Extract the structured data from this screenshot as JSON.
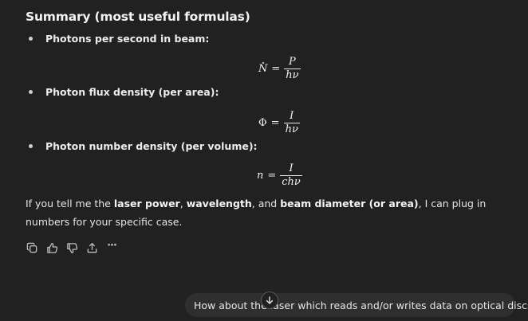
{
  "summary": {
    "heading": "Summary (most useful formulas)",
    "items": [
      {
        "label": "Photons per second in beam:",
        "lhs": "N",
        "eq": "=",
        "num": "P",
        "den": "hν"
      },
      {
        "label": "Photon flux density (per area):",
        "lhs": "Φ",
        "eq": "=",
        "num": "I",
        "den": "hν"
      },
      {
        "label": "Photon number density (per volume):",
        "lhs": "n",
        "eq": "=",
        "num": "I",
        "den": "chν"
      }
    ]
  },
  "followup": {
    "part1": "If you tell me the ",
    "bold1": "laser power",
    "sep1": ", ",
    "bold2": "wavelength",
    "sep2": ", and ",
    "bold3": "beam diameter (or area)",
    "part2": ", I can plug in numbers for your specific case."
  },
  "actions": [
    {
      "name": "copy-icon"
    },
    {
      "name": "thumbs-up-icon"
    },
    {
      "name": "thumbs-down-icon"
    },
    {
      "name": "share-icon"
    },
    {
      "name": "more-icon",
      "text": "···"
    }
  ],
  "suggestion": {
    "text": "How about the laser which reads and/or writes data on optical discs?"
  }
}
